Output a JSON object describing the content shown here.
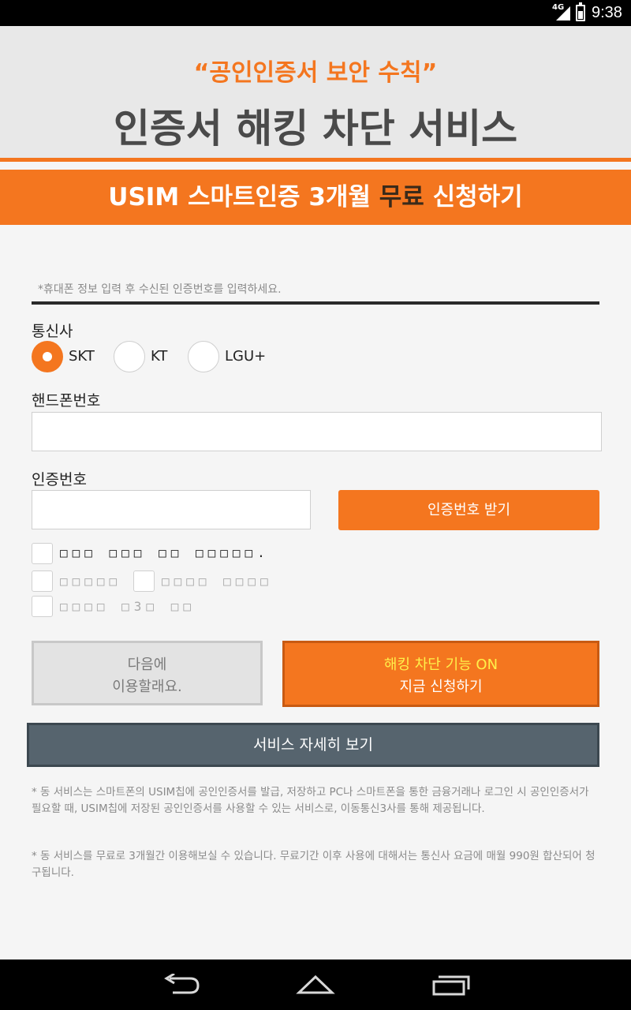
{
  "status_bar": {
    "network": "4G",
    "time": "9:38"
  },
  "header": {
    "subtitle": "“공인인증서 보안 수칙”",
    "title": "인증서 해킹 차단 서비스"
  },
  "banner": {
    "text_before": "USIM 스마트인증 3개월 ",
    "text_highlight": "무료",
    "text_after": " 신청하기"
  },
  "form": {
    "notice": "*휴대폰 정보 입력 후 수신된 인증번호를 입력하세요.",
    "carrier_label": "통신사",
    "carriers": [
      "SKT",
      "KT",
      "LGU+"
    ],
    "selected_carrier": "SKT",
    "phone_label": "핸드폰번호",
    "phone_value": "",
    "code_label": "인증번호",
    "code_value": "",
    "get_code_button": "인증번호 받기",
    "agree_all": "□□□ □□□ □□ □□□□□.",
    "agree_1": "□□□□□",
    "agree_2": "□□□□ □□□□",
    "agree_3": "□□□□ □3□ □□"
  },
  "actions": {
    "later_line1": "다음에",
    "later_line2": "이용할래요.",
    "apply_line1": "해킹 차단 기능 ON",
    "apply_line2": "지금 신청하기",
    "detail_button": "서비스 자세히 보기"
  },
  "footnotes": {
    "note1": "* 동 서비스는 스마트폰의 USIM칩에 공인인증서를 발급, 저장하고 PC나 스마트폰을 통한 금융거래나 로그인 시 공인인증서가 필요할 때, USIM칩에 저장된 공인인증서를 사용할 수 있는 서비스로, 이동통신3사를 통해 제공됩니다.",
    "note2": "* 동 서비스를 무료로 3개월간 이용해보실 수 있습니다. 무료기간 이후 사용에 대해서는 통신사 요금에 매월 990원 합산되어 청구됩니다."
  },
  "colors": {
    "accent": "#f4761f",
    "dark_button": "#56646e",
    "highlight": "#fff04a"
  }
}
